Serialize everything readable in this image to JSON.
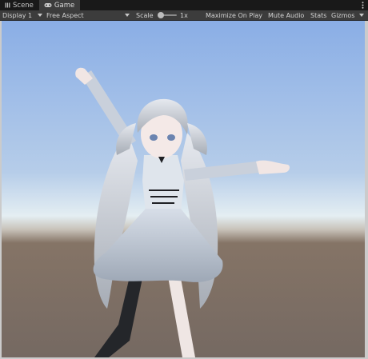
{
  "tabs": [
    {
      "label": "Scene",
      "icon": "scene-hash-icon",
      "active": false
    },
    {
      "label": "Game",
      "icon": "gamepad-icon",
      "active": true
    }
  ],
  "toolbar": {
    "display": "Display 1",
    "aspect": "Free Aspect",
    "scale_label": "Scale",
    "scale_value": "1x",
    "maximize": "Maximize On Play",
    "mute": "Mute Audio",
    "stats": "Stats",
    "gizmos": "Gizmos"
  },
  "colors": {
    "tabbar_bg": "#191919",
    "toolbar_bg": "#3c3c3c",
    "sky_top": "#8fb0e4",
    "horizon": "#dfeaf1",
    "ground": "#7c6d64"
  }
}
